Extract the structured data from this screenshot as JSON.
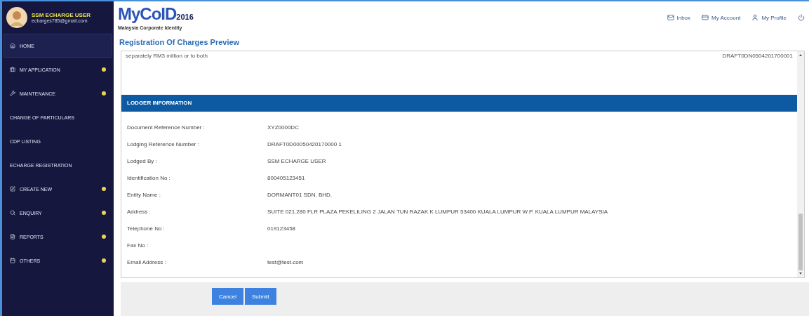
{
  "user": {
    "name": "SSM ECHARGE USER",
    "email": "echarges785@gmail.com"
  },
  "sidebar": {
    "items": [
      {
        "label": "HOME",
        "kind": "home",
        "selected": true,
        "expandable": false
      },
      {
        "label": "MY APPLICATION",
        "kind": "briefcase",
        "selected": false,
        "expandable": true
      },
      {
        "label": "MAINTENANCE",
        "kind": "wrench",
        "selected": false,
        "expandable": true
      },
      {
        "label": "CHANGE OF PARTICULARS",
        "kind": "plain",
        "selected": false,
        "expandable": false
      },
      {
        "label": "CDP LISTING",
        "kind": "plain",
        "selected": false,
        "expandable": false
      },
      {
        "label": "ECHARGE REGISTRATION",
        "kind": "plain",
        "selected": false,
        "expandable": false
      },
      {
        "label": "CREATE NEW",
        "kind": "edit",
        "selected": false,
        "expandable": true
      },
      {
        "label": "ENQUIRY",
        "kind": "search",
        "selected": false,
        "expandable": true
      },
      {
        "label": "REPORTS",
        "kind": "file",
        "selected": false,
        "expandable": true
      },
      {
        "label": "OTHERS",
        "kind": "calendar",
        "selected": false,
        "expandable": true
      }
    ]
  },
  "logo": {
    "brand": "MyCoID",
    "year": "2016",
    "tagline": "Malaysia Corporate Identity"
  },
  "top_links": [
    {
      "label": "Inbox",
      "kind": "mail"
    },
    {
      "label": "My Account",
      "kind": "card"
    },
    {
      "label": "My Profile",
      "kind": "user"
    },
    {
      "kind": "power"
    }
  ],
  "page_title": "Registration Of Charges Preview",
  "preview": {
    "top_text": "separately RM3 million or to both",
    "top_reference": "DRAFT0DN0504201700001",
    "section_title": "LODGER INFORMATION",
    "rows": [
      {
        "label": "Document Reference Number :",
        "value": "XYZ0000DC"
      },
      {
        "label": "Lodging Reference Number :",
        "value": "DRAFT0D00050420170000 1"
      },
      {
        "label": "Lodged By :",
        "value": "SSM ECHARGE USER"
      },
      {
        "label": "Identification No :",
        "value": "800405123451"
      },
      {
        "label": "Entity Name :",
        "value": "DORMANT01 SDN. BHD."
      },
      {
        "label": "Address :",
        "value": "SUITE 021.280 FLR PLAZA PEKELILING 2 JALAN TUN RAZAK K LUMPUR 53400 KUALA LUMPUR W.P. KUALA LUMPUR MALAYSIA"
      },
      {
        "label": "Telephone No :",
        "value": "019123458"
      },
      {
        "label": "Fax No :"
      },
      {
        "label": "Email Address :",
        "value": "test@test.com"
      }
    ]
  },
  "buttons": [
    "Cancel",
    "Submit"
  ]
}
